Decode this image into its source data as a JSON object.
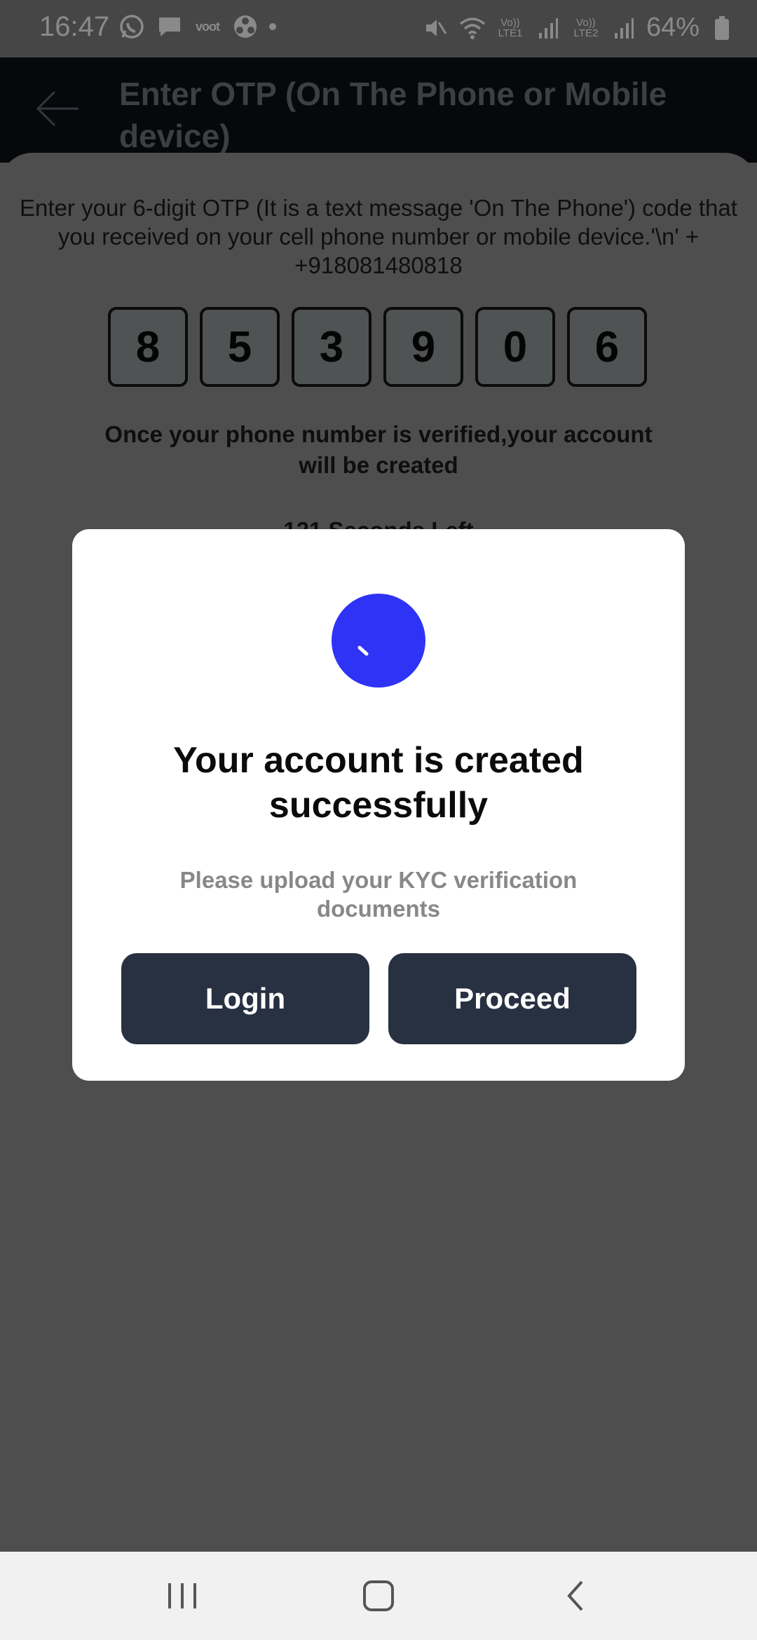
{
  "status_bar": {
    "time": "16:47",
    "icons_left": [
      "whatsapp-icon",
      "message-icon",
      "voot-icon",
      "fan-icon"
    ],
    "voot_label": "voot",
    "sim1_label": "Vo)) LTE1",
    "sim2_label": "Vo)) LTE2",
    "battery": "64%"
  },
  "app_bar": {
    "title": "Enter OTP (On The Phone or Mobile device)"
  },
  "otp_screen": {
    "description": "Enter your 6-digit OTP (It is a text message 'On The Phone') code that you received on your cell phone number or mobile device.'\\n' + +918081480818",
    "digits": [
      "8",
      "5",
      "3",
      "9",
      "0",
      "6"
    ],
    "verify_note": "Once your phone number is verified,your account will be created",
    "timer": "121 Seconds Left"
  },
  "dialog": {
    "title": "Your account is created successfully",
    "subtitle": "Please upload your KYC verification documents",
    "login_label": "Login",
    "proceed_label": "Proceed",
    "accent_color": "#2f33f5",
    "button_color": "#273141"
  },
  "nav_bar": {
    "buttons": [
      "recent-apps-icon",
      "home-icon",
      "back-icon"
    ]
  }
}
